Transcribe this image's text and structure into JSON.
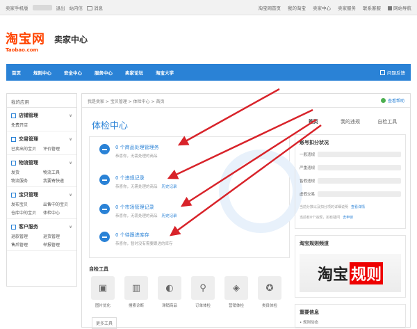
{
  "topbar": {
    "left": [
      "卖家手机版",
      "退出",
      "站内信",
      "消息"
    ],
    "right": [
      "淘宝网首页",
      "我的淘宝",
      "卖家中心",
      "卖家服务",
      "联系客服",
      "网站导航"
    ]
  },
  "header": {
    "logo_cn": "淘宝网",
    "logo_en": "Taobao.com",
    "title": "卖家中心"
  },
  "nav": {
    "items": [
      "首页",
      "规则中心",
      "安全中心",
      "服务中心",
      "卖家论坛",
      "淘宝大学"
    ],
    "help": "问题反馈"
  },
  "sidebar": {
    "title": "我的应用",
    "sections": [
      {
        "title": "店铺管理",
        "links": [
          "免费开店",
          ""
        ]
      },
      {
        "title": "交易管理",
        "links": [
          "已卖出的宝贝",
          "评价管理"
        ]
      },
      {
        "title": "物流管理",
        "links": [
          "发货",
          "物流工具",
          "物流服务",
          "我要寄快递"
        ]
      },
      {
        "title": "宝贝管理",
        "links": [
          "发布宝贝",
          "出售中的宝贝",
          "仓库中的宝贝",
          "体检中心"
        ]
      },
      {
        "title": "客户服务",
        "links": [
          "退款管理",
          "退货管理",
          "售后管理",
          "举报管理"
        ]
      }
    ]
  },
  "main": {
    "breadcrumb": "我是卖家 > 宝贝管理 > 体检中心 > 首页",
    "help_btn": "查看帮助",
    "title": "体检中心",
    "items": [
      {
        "title": "0 个商品处理管理务",
        "desc": "恭喜你，无需处理的商品"
      },
      {
        "title": "0 个违规记录",
        "desc": "恭喜你，无需处理的商品",
        "link": "历史记录"
      },
      {
        "title": "0 个市场管理记录",
        "desc": "恭喜你，无需处理的商品",
        "link": "历史记录"
      },
      {
        "title": "0 个待跟进库存",
        "desc": "恭喜你，暂时没有需要跟进的库存"
      }
    ],
    "tools_title": "自检工具",
    "tools": [
      {
        "label": "图片优化",
        "icon": "image-icon"
      },
      {
        "label": "搜索诊断",
        "icon": "bars-icon"
      },
      {
        "label": "滞销商品",
        "icon": "chart-icon"
      },
      {
        "label": "订单体检",
        "icon": "thermometer-icon"
      },
      {
        "label": "营销体检",
        "icon": "tag-icon"
      },
      {
        "label": "类目体检",
        "icon": "award-icon"
      }
    ],
    "more": "更多工具"
  },
  "right": {
    "tabs": [
      "首页",
      "我的违规",
      "自检工具"
    ],
    "deduct_title": "账号扣分状况",
    "deduct_rows": [
      "一般违规",
      "严重违规",
      "售假违规",
      "虚假交易"
    ],
    "note": "当前分数以及扣分项的详细说明",
    "note_link": "查看详情",
    "note2": "当前有0个违规，如有疑问",
    "note2_link": "去申诉",
    "rules_title": "淘宝规则频道",
    "banner_a": "淘宝",
    "banner_b": "规则",
    "news_title": "重要信息",
    "news_item": "• 规则动态"
  }
}
